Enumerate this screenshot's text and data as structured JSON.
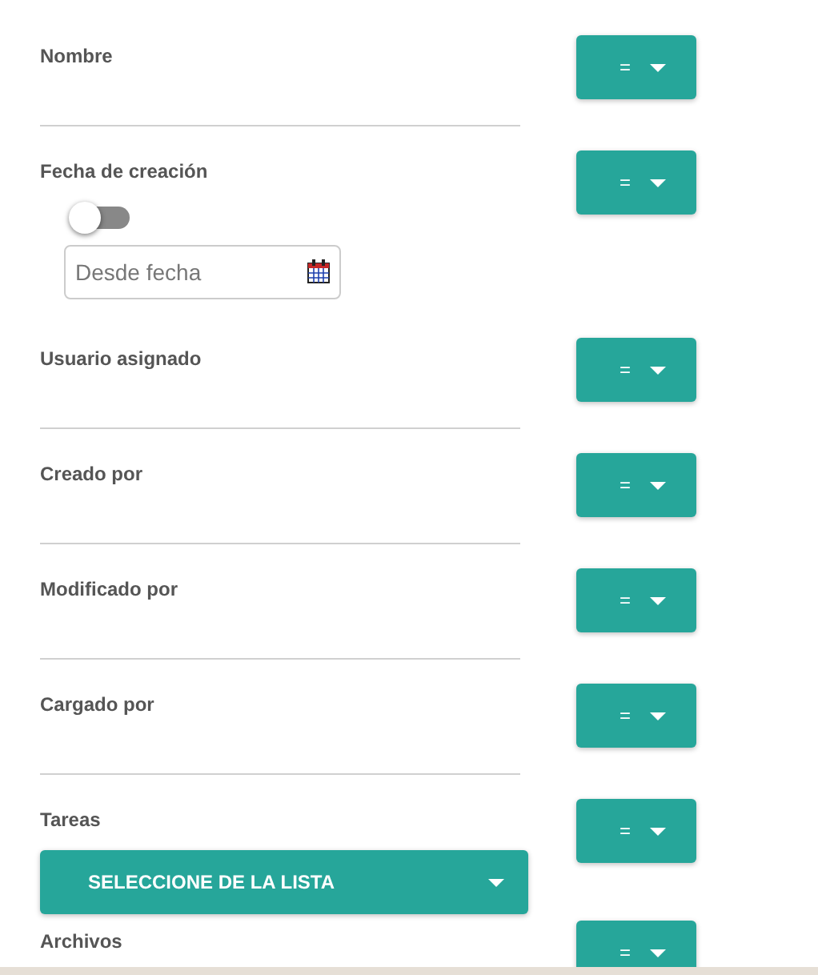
{
  "filters": [
    {
      "kind": "text",
      "label": "Nombre",
      "operator": "="
    },
    {
      "kind": "date",
      "label": "Fecha de creación",
      "operator": "=",
      "toggle": {
        "on": false
      },
      "date_field": {
        "placeholder": "Desde fecha"
      }
    },
    {
      "kind": "text",
      "label": "Usuario asignado",
      "operator": "="
    },
    {
      "kind": "text",
      "label": "Creado por",
      "operator": "="
    },
    {
      "kind": "text",
      "label": "Modificado por",
      "operator": "="
    },
    {
      "kind": "text",
      "label": "Cargado por",
      "operator": "="
    },
    {
      "kind": "select",
      "label": "Tareas",
      "operator": "=",
      "select": {
        "value": "SELECCIONE DE LA LISTA"
      }
    },
    {
      "kind": "label_only",
      "label": "Archivos",
      "operator": "="
    }
  ]
}
